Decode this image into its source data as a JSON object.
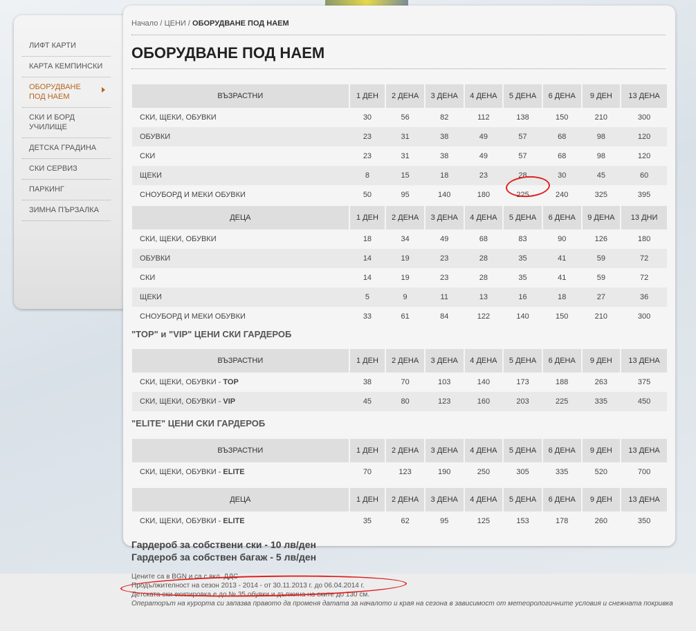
{
  "sidebar": {
    "items": [
      {
        "label": "ЛИФТ КАРТИ"
      },
      {
        "label": "КАРТА КЕМПИНСКИ"
      },
      {
        "label": "ОБОРУДВАНЕ ПОД НАЕМ"
      },
      {
        "label": "СКИ И БОРД УЧИЛИЩЕ"
      },
      {
        "label": "ДЕТСКА ГРАДИНА"
      },
      {
        "label": "СКИ СЕРВИЗ"
      },
      {
        "label": "ПАРКИНГ"
      },
      {
        "label": "ЗИМНА ПЪРЗАЛКА"
      }
    ]
  },
  "breadcrumb": {
    "home": "Начало",
    "sep": "/",
    "prices": "ЦЕНИ",
    "current": "ОБОРУДВАНЕ ПОД НАЕМ"
  },
  "page_title": "ОБОРУДВАНЕ ПОД НАЕМ",
  "tables": {
    "adults": {
      "headers": [
        "ВЪЗРАСТНИ",
        "1 ДЕН",
        "2 ДЕНА",
        "3 ДЕНА",
        "4 ДЕНА",
        "5 ДЕНА",
        "6 ДЕНА",
        "9 ДЕН",
        "13 ДЕНА"
      ],
      "rows": [
        [
          "СКИ, ЩЕКИ, ОБУВКИ",
          "30",
          "56",
          "82",
          "112",
          "138",
          "150",
          "210",
          "300"
        ],
        [
          "ОБУВКИ",
          "23",
          "31",
          "38",
          "49",
          "57",
          "68",
          "98",
          "120"
        ],
        [
          "СКИ",
          "23",
          "31",
          "38",
          "49",
          "57",
          "68",
          "98",
          "120"
        ],
        [
          "ЩЕКИ",
          "8",
          "15",
          "18",
          "23",
          "28",
          "30",
          "45",
          "60"
        ],
        [
          "СНОУБОРД И МЕКИ ОБУВКИ",
          "50",
          "95",
          "140",
          "180",
          "225",
          "240",
          "325",
          "395"
        ]
      ]
    },
    "kids": {
      "headers": [
        "ДЕЦА",
        "1 ДЕН",
        "2 ДЕНА",
        "3 ДЕНА",
        "4 ДЕНА",
        "5 ДЕНА",
        "6 ДЕНА",
        "9 ДЕНА",
        "13 ДНИ"
      ],
      "rows": [
        [
          "СКИ, ЩЕКИ, ОБУВКИ",
          "18",
          "34",
          "49",
          "68",
          "83",
          "90",
          "126",
          "180"
        ],
        [
          "ОБУВКИ",
          "14",
          "19",
          "23",
          "28",
          "35",
          "41",
          "59",
          "72"
        ],
        [
          "СКИ",
          "14",
          "19",
          "23",
          "28",
          "35",
          "41",
          "59",
          "72"
        ],
        [
          "ЩЕКИ",
          "5",
          "9",
          "11",
          "13",
          "16",
          "18",
          "27",
          "36"
        ],
        [
          "СНОУБОРД И МЕКИ ОБУВКИ",
          "33",
          "61",
          "84",
          "122",
          "140",
          "150",
          "210",
          "300"
        ]
      ]
    },
    "top_vip_title": "\"TOP\" и \"VIP\" ЦЕНИ СКИ ГАРДЕРОБ",
    "top_vip": {
      "headers": [
        "ВЪЗРАСТНИ",
        "1 ДЕН",
        "2 ДЕНА",
        "3 ДЕНА",
        "4 ДЕНА",
        "5 ДЕНА",
        "6 ДЕНА",
        "9 ДЕН",
        "13 ДЕНА"
      ],
      "rows": [
        [
          "СКИ, ЩЕКИ, ОБУВКИ - ",
          "TOP",
          "38",
          "70",
          "103",
          "140",
          "173",
          "188",
          "263",
          "375"
        ],
        [
          "СКИ, ЩЕКИ, ОБУВКИ - ",
          "VIP",
          "45",
          "80",
          "123",
          "160",
          "203",
          "225",
          "335",
          "450"
        ]
      ]
    },
    "elite_title": "\"ELITE\" ЦЕНИ СКИ ГАРДЕРОБ",
    "elite_adults": {
      "headers": [
        "ВЪЗРАСТНИ",
        "1 ДЕН",
        "2 ДЕНА",
        "3 ДЕНА",
        "4 ДЕНА",
        "5 ДЕНА",
        "6 ДЕНА",
        "9 ДЕН",
        "13 ДЕНА"
      ],
      "rows": [
        [
          "СКИ, ЩЕКИ, ОБУВКИ - ",
          "ELITE",
          "70",
          "123",
          "190",
          "250",
          "305",
          "335",
          "520",
          "700"
        ]
      ]
    },
    "elite_kids": {
      "headers": [
        "ДЕЦА",
        "1 ДЕН",
        "2 ДЕНА",
        "3 ДЕНА",
        "4 ДЕНА",
        "5 ДЕНА",
        "6 ДЕНА",
        "9 ДЕН",
        "13 ДЕНА"
      ],
      "rows": [
        [
          "СКИ, ЩЕКИ, ОБУВКИ - ",
          "ELITE",
          "35",
          "62",
          "95",
          "125",
          "153",
          "178",
          "260",
          "350"
        ]
      ]
    }
  },
  "storage_notes": [
    "Гардероб за собствени ски - 10 лв/ден",
    "Гардероб за собствен багаж - 5 лв/ден"
  ],
  "footnotes": [
    "Цените са в BGN и са с вкл. ДДС",
    "Продължителност на сезон 2013 - 2014 - от 30.11.2013 г.  до 06.04.2014 г.",
    "Детската ски екипировка е до № 35 обувки и дължина на ските до 130 см."
  ],
  "footnote_italic": "Операторът на курорта си запазва правото да променя датата за началото и края на сезона в зависимост от метеорологичните условия и снежната покривка",
  "colors": {
    "accent": "#b5651d",
    "annotation": "#e02020",
    "header_bg": "#dedede",
    "row_alt": "#e9e9e9"
  }
}
